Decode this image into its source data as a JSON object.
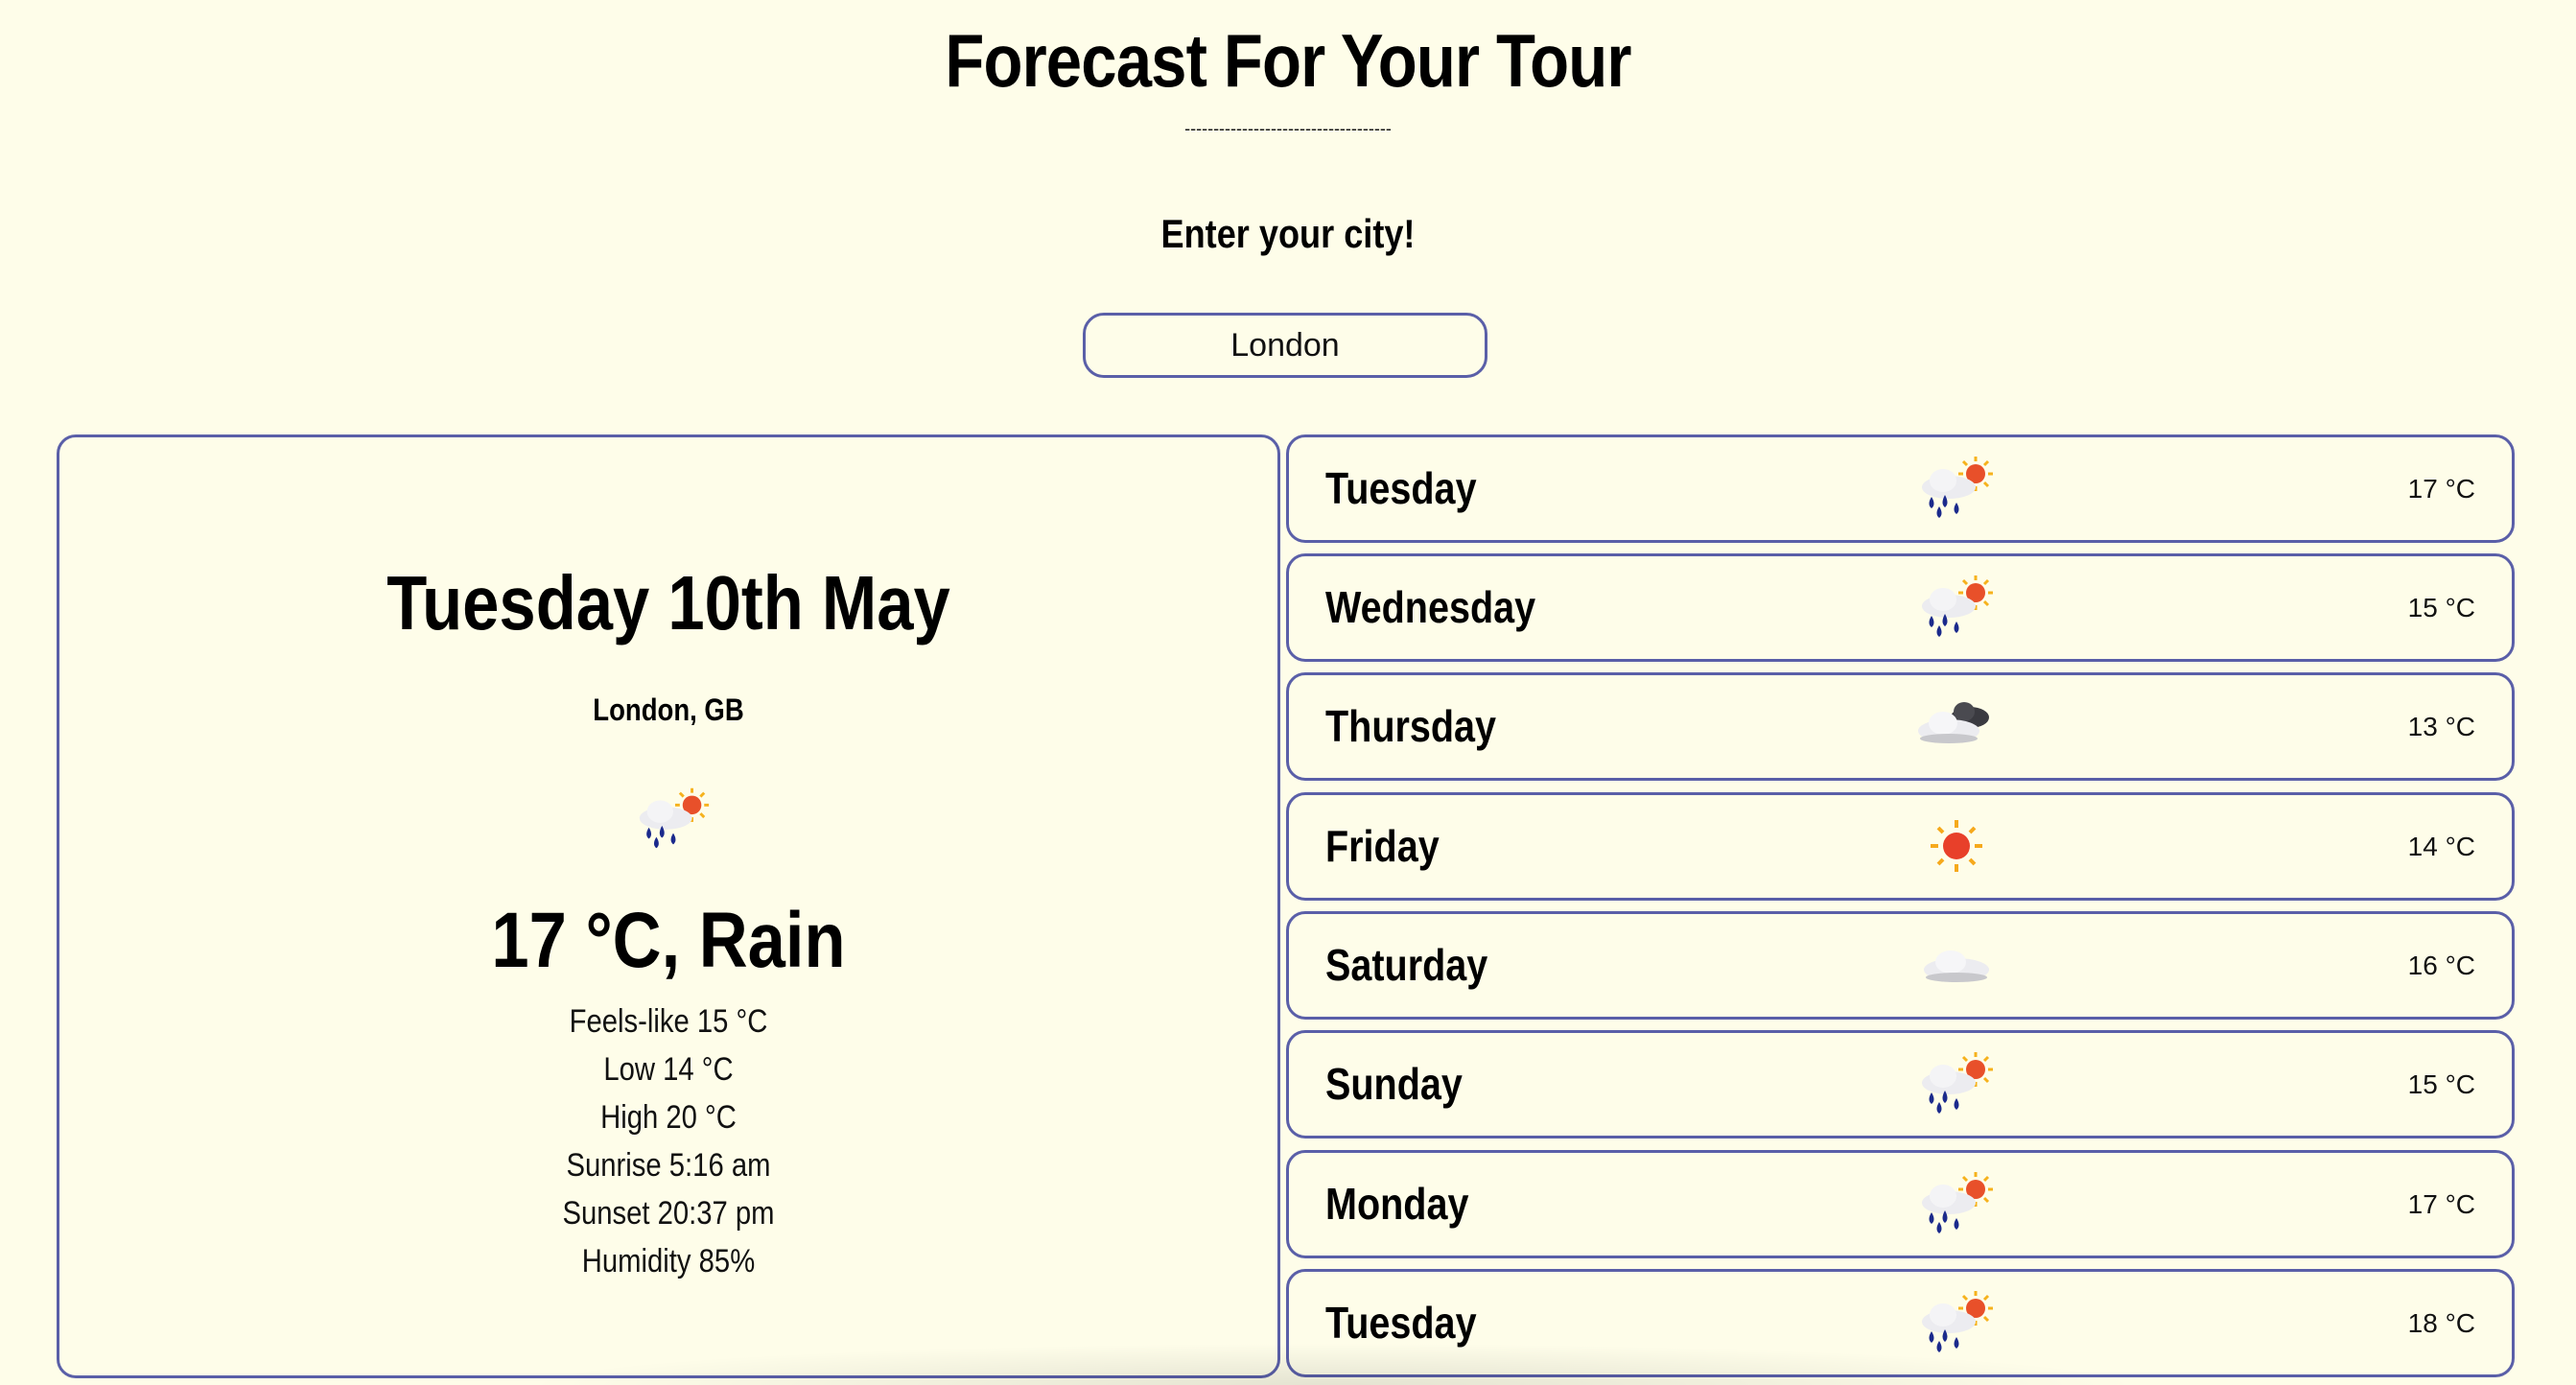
{
  "header": {
    "title": "Forecast For Your Tour",
    "divider": "------------------------------------",
    "prompt": "Enter your city!"
  },
  "search": {
    "value": "London"
  },
  "current": {
    "date": "Tuesday 10th May",
    "location": "London, GB",
    "icon": "rain-sun-icon",
    "summary": "17 °C, Rain",
    "details": [
      "Feels-like 15 °C",
      "Low 14 °C",
      "High 20 °C",
      "Sunrise 5:16 am",
      "Sunset 20:37 pm",
      "Humidity 85%"
    ]
  },
  "forecast": [
    {
      "day": "Tuesday",
      "icon": "rain-sun-icon",
      "temp": "17 °C"
    },
    {
      "day": "Wednesday",
      "icon": "rain-sun-icon",
      "temp": "15 °C"
    },
    {
      "day": "Thursday",
      "icon": "cloudy-icon",
      "temp": "13 °C"
    },
    {
      "day": "Friday",
      "icon": "sun-icon",
      "temp": "14 °C"
    },
    {
      "day": "Saturday",
      "icon": "cloud-icon",
      "temp": "16 °C"
    },
    {
      "day": "Sunday",
      "icon": "rain-sun-icon",
      "temp": "15 °C"
    },
    {
      "day": "Monday",
      "icon": "rain-sun-icon",
      "temp": "17 °C"
    },
    {
      "day": "Tuesday",
      "icon": "rain-sun-icon",
      "temp": "18 °C"
    }
  ],
  "colors": {
    "background": "#fefde9",
    "border": "#5a5fa8"
  }
}
